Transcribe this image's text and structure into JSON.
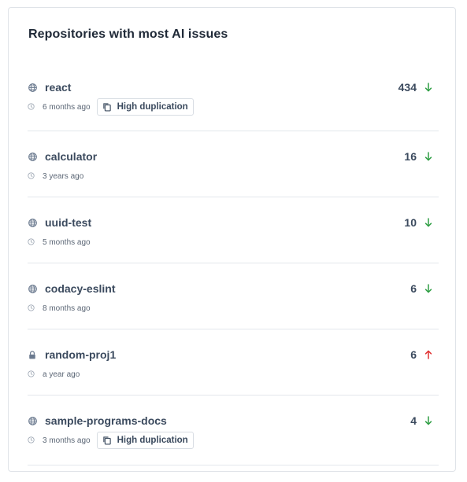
{
  "card": {
    "title": "Repositories with most AI issues"
  },
  "colors": {
    "down": "#2f9e44",
    "up": "#e03131",
    "icon": "#6b7a8f"
  },
  "repos": [
    {
      "name": "react",
      "visibility": "globe-icon",
      "time": "6 months ago",
      "badge": "High duplication",
      "count": "434",
      "trend": "arrow-down-icon"
    },
    {
      "name": "calculator",
      "visibility": "globe-icon",
      "time": "3 years ago",
      "badge": "",
      "count": "16",
      "trend": "arrow-down-icon"
    },
    {
      "name": "uuid-test",
      "visibility": "globe-icon",
      "time": "5 months ago",
      "badge": "",
      "count": "10",
      "trend": "arrow-down-icon"
    },
    {
      "name": "codacy-eslint",
      "visibility": "globe-icon",
      "time": "8 months ago",
      "badge": "",
      "count": "6",
      "trend": "arrow-down-icon"
    },
    {
      "name": "random-proj1",
      "visibility": "lock-icon",
      "time": "a year ago",
      "badge": "",
      "count": "6",
      "trend": "arrow-up-icon"
    },
    {
      "name": "sample-programs-docs",
      "visibility": "globe-icon",
      "time": "3 months ago",
      "badge": "High duplication",
      "count": "4",
      "trend": "arrow-down-icon"
    }
  ]
}
